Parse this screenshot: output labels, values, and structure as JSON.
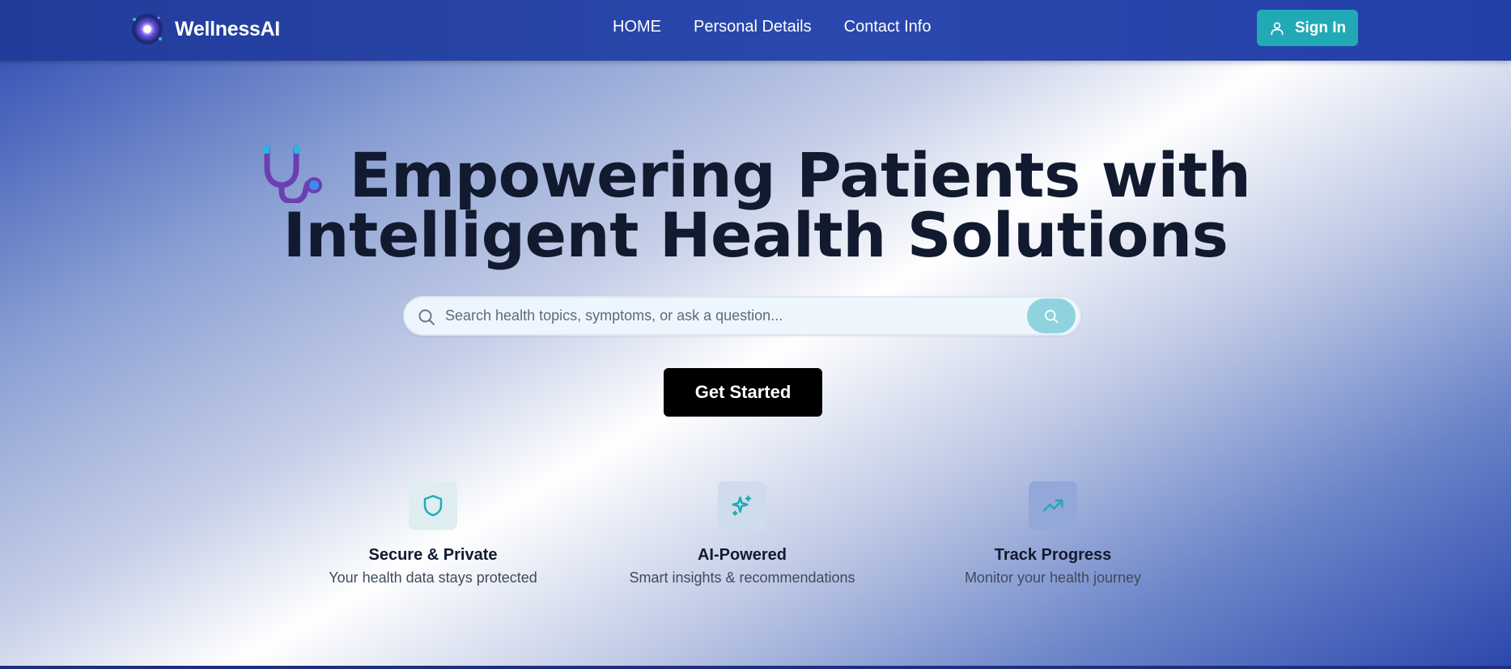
{
  "header": {
    "brand": "WellnessAI",
    "nav": [
      "HOME",
      "Personal Details",
      "Contact Info"
    ],
    "signin_label": "Sign In",
    "icons": {
      "logo": "orb-logo-icon",
      "signin": "user-icon"
    }
  },
  "hero": {
    "headline_line1": "Empowering Patients with",
    "headline_line2": "Intelligent Health Solutions",
    "headline_icon": "stethoscope-icon",
    "search": {
      "placeholder": "Search health topics, symptoms, or ask a question...",
      "value": "",
      "icons": [
        "search-icon",
        "search-icon"
      ]
    },
    "cta_label": "Get Started"
  },
  "features": [
    {
      "icon": "shield-icon",
      "title": "Secure & Private",
      "description": "Your health data stays protected"
    },
    {
      "icon": "sparkles-icon",
      "title": "AI-Powered",
      "description": "Smart insights & recommendations"
    },
    {
      "icon": "trending-up-icon",
      "title": "Track Progress",
      "description": "Monitor your health journey"
    }
  ],
  "colors": {
    "navbar": "#223c9b",
    "accent": "#22a9b6",
    "search_button": "#8fd3de",
    "cta": "#000000",
    "headline": "#111a2e"
  }
}
